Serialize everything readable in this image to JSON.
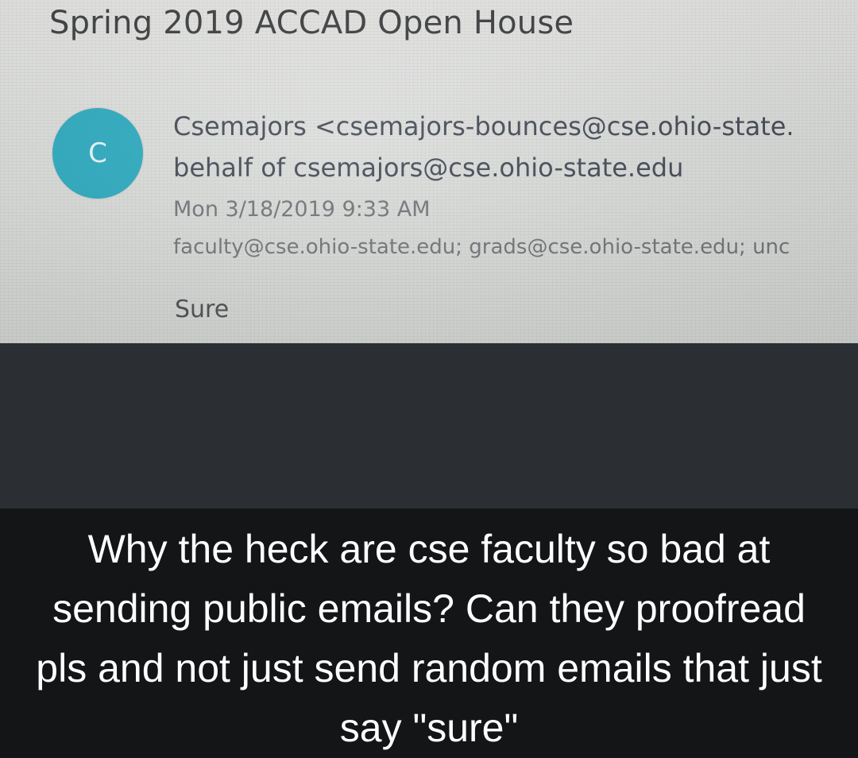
{
  "email": {
    "subject": "Spring 2019 ACCAD Open House",
    "avatar_letter": "C",
    "sender": "Csemajors <csemajors-bounces@cse.ohio-state.",
    "on_behalf_of": "behalf of csemajors@cse.ohio-state.edu",
    "date": "Mon 3/18/2019 9:33 AM",
    "recipients": "faculty@cse.ohio-state.edu; grads@cse.ohio-state.edu; unc",
    "body": "Sure"
  },
  "caption": {
    "text": "Why the heck are cse faculty so bad at sending public emails? Can they proofread pls and not just send random emails that just say \"sure\""
  },
  "colors": {
    "avatar": "#27a7bd",
    "caption_background": "#141517",
    "band_background": "#2b2f33"
  }
}
